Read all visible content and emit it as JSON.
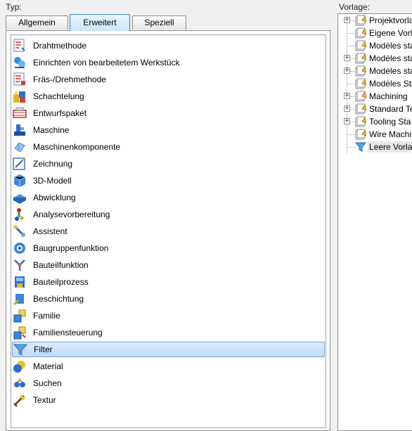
{
  "labels": {
    "typ": "Typ:",
    "vorlage": "Vorlage:"
  },
  "tabs": [
    {
      "label": "Allgemein",
      "active": false
    },
    {
      "label": "Erweitert",
      "active": true
    },
    {
      "label": "Speziell",
      "active": false
    }
  ],
  "type_list": {
    "selected": "Filter",
    "items": [
      {
        "label": "Drahtmethode",
        "icon": "wire-method-icon"
      },
      {
        "label": "Einrichten von bearbeitetem Werkstück",
        "icon": "setup-workpiece-icon"
      },
      {
        "label": "Fräs-/Drehmethode",
        "icon": "mill-turn-method-icon"
      },
      {
        "label": "Schachtelung",
        "icon": "nesting-icon"
      },
      {
        "label": "Entwurfspaket",
        "icon": "design-package-icon"
      },
      {
        "label": "Maschine",
        "icon": "machine-icon"
      },
      {
        "label": "Maschinenkomponente",
        "icon": "machine-component-icon"
      },
      {
        "label": "Zeichnung",
        "icon": "drawing-icon"
      },
      {
        "label": "3D-Modell",
        "icon": "3d-model-icon"
      },
      {
        "label": "Abwicklung",
        "icon": "unfold-icon"
      },
      {
        "label": "Analysevorbereitung",
        "icon": "analysis-prep-icon"
      },
      {
        "label": "Assistent",
        "icon": "assistant-icon"
      },
      {
        "label": "Baugruppenfunktion",
        "icon": "assembly-feature-icon"
      },
      {
        "label": "Bauteilfunktion",
        "icon": "part-feature-icon"
      },
      {
        "label": "Bauteilprozess",
        "icon": "part-process-icon"
      },
      {
        "label": "Beschichtung",
        "icon": "coating-icon"
      },
      {
        "label": "Familie",
        "icon": "family-icon"
      },
      {
        "label": "Familiensteuerung",
        "icon": "family-control-icon"
      },
      {
        "label": "Filter",
        "icon": "filter-icon"
      },
      {
        "label": "Material",
        "icon": "material-icon"
      },
      {
        "label": "Suchen",
        "icon": "search-icon"
      },
      {
        "label": "Textur",
        "icon": "texture-icon"
      }
    ]
  },
  "template_tree": {
    "items": [
      {
        "label": "Projektvorla",
        "expandable": true,
        "icon": "template-folder-icon"
      },
      {
        "label": "Eigene Vorla",
        "expandable": false,
        "icon": "template-folder-icon"
      },
      {
        "label": "Modèles sta",
        "expandable": false,
        "icon": "template-folder-icon"
      },
      {
        "label": "Modèles sta",
        "expandable": true,
        "icon": "template-folder-icon"
      },
      {
        "label": "Modèles sta",
        "expandable": true,
        "icon": "template-folder-icon"
      },
      {
        "label": "Modèles Sta",
        "expandable": false,
        "icon": "template-folder-icon"
      },
      {
        "label": "Machining",
        "expandable": true,
        "icon": "template-folder-icon"
      },
      {
        "label": "Standard Te",
        "expandable": true,
        "icon": "template-folder-icon"
      },
      {
        "label": "Tooling Sta",
        "expandable": true,
        "icon": "template-folder-icon"
      },
      {
        "label": "Wire Machi",
        "expandable": false,
        "icon": "template-folder-icon"
      },
      {
        "label": "Leere Vorlag",
        "expandable": false,
        "icon": "empty-template-icon",
        "current": true
      }
    ]
  },
  "colors": {
    "selection_top": "#dcebfc",
    "selection_bottom": "#c1dbfc",
    "selection_border": "#7da2ce",
    "active_tab": "#c8e6f8"
  }
}
